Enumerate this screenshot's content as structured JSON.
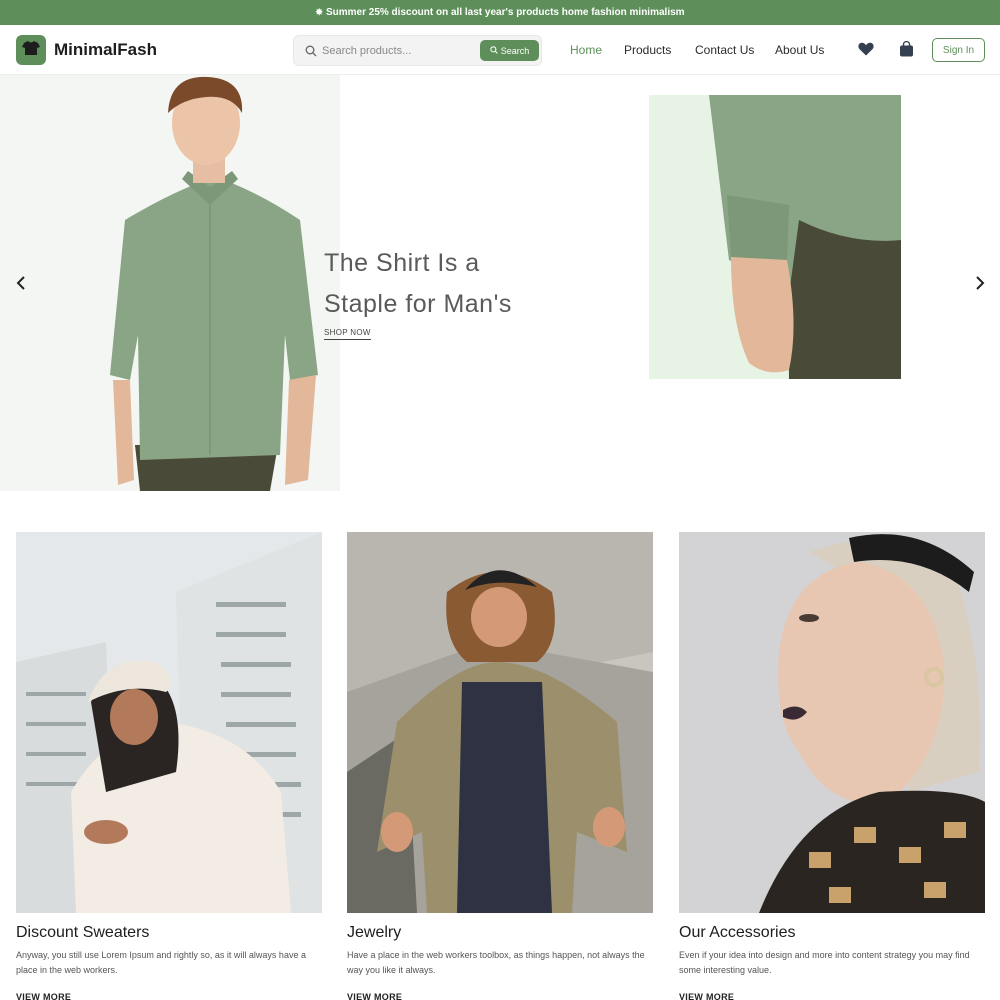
{
  "announcement": {
    "text": "Summer 25% discount on all last year's products home fashion minimalism",
    "icon": "sparkle-icon"
  },
  "brand": {
    "name": "MinimalFash",
    "logo_icon": "tshirt-icon",
    "accent": "#5e8f5a"
  },
  "search": {
    "placeholder": "Search products...",
    "button_label": "Search"
  },
  "nav": {
    "items": [
      {
        "label": "Home",
        "active": true
      },
      {
        "label": "Products",
        "active": false
      },
      {
        "label": "Contact Us",
        "active": false
      },
      {
        "label": "About Us",
        "active": false
      }
    ]
  },
  "header_actions": {
    "wishlist_icon": "heart-icon",
    "cart_icon": "shopping-bag-icon",
    "signin_label": "Sign In"
  },
  "hero": {
    "title_line1": "The Shirt Is a",
    "title_line2": "Staple for Man's",
    "cta_label": "SHOP NOW",
    "prev_icon": "chevron-left-icon",
    "next_icon": "chevron-right-icon"
  },
  "cards": [
    {
      "title": "Discount Sweaters",
      "description": "Anyway, you still use Lorem Ipsum and rightly so, as it will always have a place in the web workers.",
      "link_label": "VIEW MORE"
    },
    {
      "title": "Jewelry",
      "description": "Have a place in the web workers toolbox, as things happen, not always the way you like it always.",
      "link_label": "VIEW MORE"
    },
    {
      "title": "Our Accessories",
      "description": "Even if your idea into design and more into content strategy you may find some interesting value.",
      "link_label": "VIEW MORE"
    }
  ]
}
